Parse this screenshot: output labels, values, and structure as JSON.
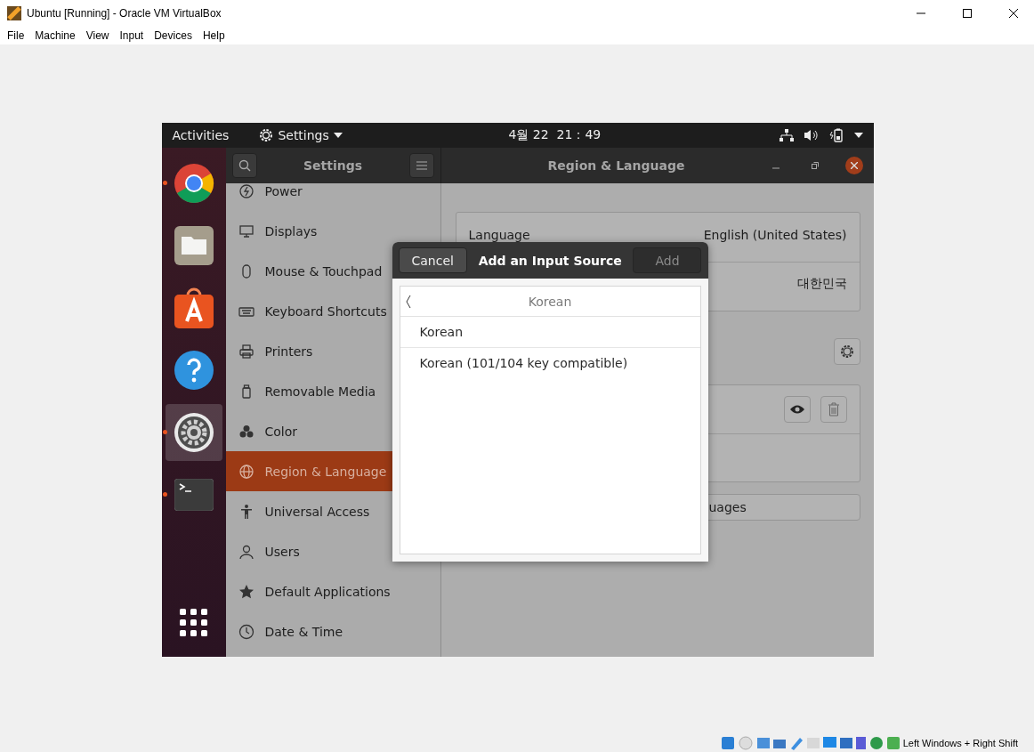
{
  "window": {
    "title": "Ubuntu [Running] - Oracle VM VirtualBox"
  },
  "menu": [
    "File",
    "Machine",
    "View",
    "Input",
    "Devices",
    "Help"
  ],
  "top_bar": {
    "activities": "Activities",
    "app_menu": "Settings",
    "clock": "4월 22  21：49"
  },
  "dock": [
    {
      "kind": "chrome",
      "running": true,
      "selected": false
    },
    {
      "kind": "files",
      "running": false,
      "selected": false
    },
    {
      "kind": "software",
      "running": false,
      "selected": false
    },
    {
      "kind": "help",
      "running": false,
      "selected": false
    },
    {
      "kind": "settings",
      "running": true,
      "selected": true
    },
    {
      "kind": "terminal",
      "running": true,
      "selected": false
    }
  ],
  "settings": {
    "title": "Settings",
    "panel_title": "Region & Language",
    "sidebar": [
      {
        "kind": "power",
        "label": "Power",
        "selected": false
      },
      {
        "kind": "display",
        "label": "Displays",
        "selected": false
      },
      {
        "kind": "mouse",
        "label": "Mouse & Touchpad",
        "selected": false
      },
      {
        "kind": "keyboard",
        "label": "Keyboard Shortcuts",
        "selected": false
      },
      {
        "kind": "printer",
        "label": "Printers",
        "selected": false
      },
      {
        "kind": "media",
        "label": "Removable Media",
        "selected": false
      },
      {
        "kind": "color",
        "label": "Color",
        "selected": false
      },
      {
        "kind": "globe",
        "label": "Region & Language",
        "selected": true
      },
      {
        "kind": "access",
        "label": "Universal Access",
        "selected": false
      },
      {
        "kind": "user",
        "label": "Users",
        "selected": false
      },
      {
        "kind": "star",
        "label": "Default Applications",
        "selected": false
      },
      {
        "kind": "clock",
        "label": "Date & Time",
        "selected": false
      }
    ],
    "rows": [
      {
        "label": "Language",
        "value": "English (United States)"
      },
      {
        "value": "대한민국"
      }
    ],
    "manage_button": "uages"
  },
  "dialog": {
    "cancel": "Cancel",
    "title": "Add an Input Source",
    "add": "Add",
    "add_disabled": true,
    "header": "Korean",
    "options": [
      "Korean",
      "Korean (101/104 key compatible)"
    ]
  },
  "status_bar": {
    "hint": "Left Windows + Right Shift"
  }
}
